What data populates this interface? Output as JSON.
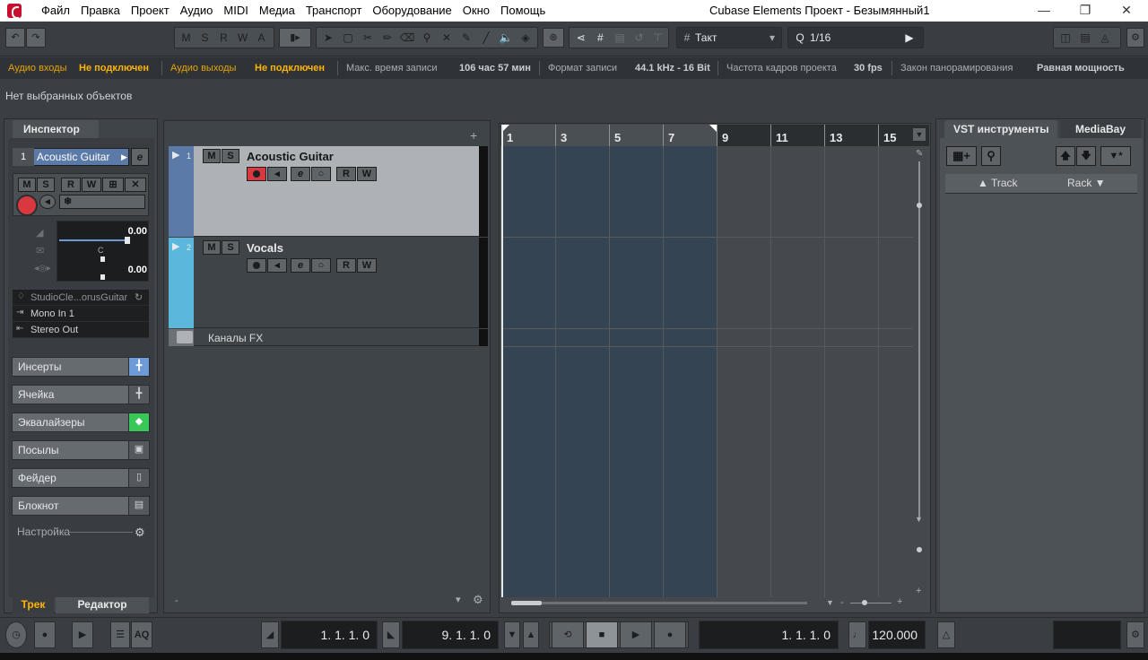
{
  "titlebar": {
    "title": "Cubase Elements Проект - Безымянный1",
    "menu": [
      "Файл",
      "Правка",
      "Проект",
      "Аудио",
      "MIDI",
      "Медиа",
      "Транспорт",
      "Оборудование",
      "Окно",
      "Помощь"
    ]
  },
  "toolbar": {
    "msr": [
      "M",
      "S",
      "R",
      "W",
      "A"
    ],
    "grid_type": "Такт",
    "quantize": "1/16"
  },
  "status": {
    "audio_in_label": "Аудио входы",
    "audio_in_value": "Не подключен",
    "audio_out_label": "Аудио выходы",
    "audio_out_value": "Не подключен",
    "rec_time_label": "Макс. время записи",
    "rec_time_value": "106 час 57 мин",
    "rec_format_label": "Формат записи",
    "rec_format_value": "44.1 kHz - 16 Bit",
    "frame_label": "Частота кадров проекта",
    "frame_value": "30 fps",
    "pan_label": "Закон панорамирования",
    "pan_value": "Равная мощность"
  },
  "info_line": "Нет выбранных объектов",
  "inspector": {
    "tab": "Инспектор",
    "track_number": "1",
    "track_name": "Acoustic Guitar",
    "btns": [
      "M",
      "S",
      "R",
      "W"
    ],
    "vol_value": "0.00",
    "pan_value": "0.00",
    "pan_center": "C",
    "preset": "StudioCle...orusGuitar",
    "input": "Mono In 1",
    "output": "Stereo Out",
    "sections": [
      "Инсерты",
      "Ячейка",
      "Эквалайзеры",
      "Посылы",
      "Фейдер",
      "Блокнот"
    ],
    "settings": "Настройка",
    "bottom_tabs": [
      "Трек",
      "Редактор"
    ]
  },
  "tracks": [
    {
      "num": "1",
      "name": "Acoustic Guitar",
      "m": "M",
      "s": "S",
      "r": "R",
      "w": "W"
    },
    {
      "num": "2",
      "name": "Vocals",
      "m": "M",
      "s": "S",
      "r": "R",
      "w": "W"
    }
  ],
  "fx_folder": "Каналы FX",
  "ruler": [
    "1",
    "3",
    "5",
    "7",
    "9",
    "11",
    "13",
    "15"
  ],
  "right_panel": {
    "tabs": [
      "VST инструменты",
      "MediaBay"
    ],
    "col_track": "Track",
    "col_rack": "Rack"
  },
  "transport": {
    "left_locator": "1. 1. 1.   0",
    "right_locator": "9. 1. 1.   0",
    "position": "1. 1. 1.   0",
    "tempo": "120.000",
    "aq": "AQ"
  },
  "colors": {
    "accent": "#e8a400",
    "track1": "#5b7aa8",
    "track2": "#5bb7dc",
    "cycle": "#354453",
    "record": "#d9383f"
  }
}
